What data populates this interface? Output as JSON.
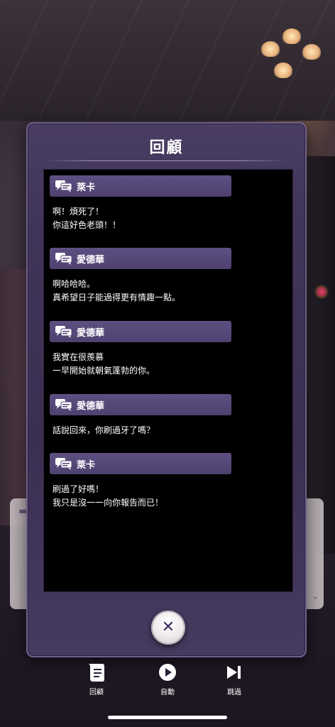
{
  "modal": {
    "title": "回顧",
    "close_icon": "close-x-icon"
  },
  "entries": [
    {
      "speaker": "萊卡",
      "text": "啊！煩死了！\n你這好色老頭！！"
    },
    {
      "speaker": "愛德華",
      "text": "啊哈哈哈。\n真希望日子能過得更有情趣一點。"
    },
    {
      "speaker": "愛德華",
      "text": "我實在很羨慕\n一早開始就朝氣蓬勃的你。"
    },
    {
      "speaker": "愛德華",
      "text": "話說回來，你刷過牙了嗎？"
    },
    {
      "speaker": "萊卡",
      "text": "刷過了好嗎！\n我只是沒一一向你報告而已！"
    }
  ],
  "toolbar": {
    "log_label": "回顧",
    "auto_label": "自動",
    "skip_label": "跳過"
  },
  "colors": {
    "modal_bg": "#403458",
    "speaker_bar": "#564879",
    "log_bg": "#000000",
    "text": "#ffffff"
  }
}
